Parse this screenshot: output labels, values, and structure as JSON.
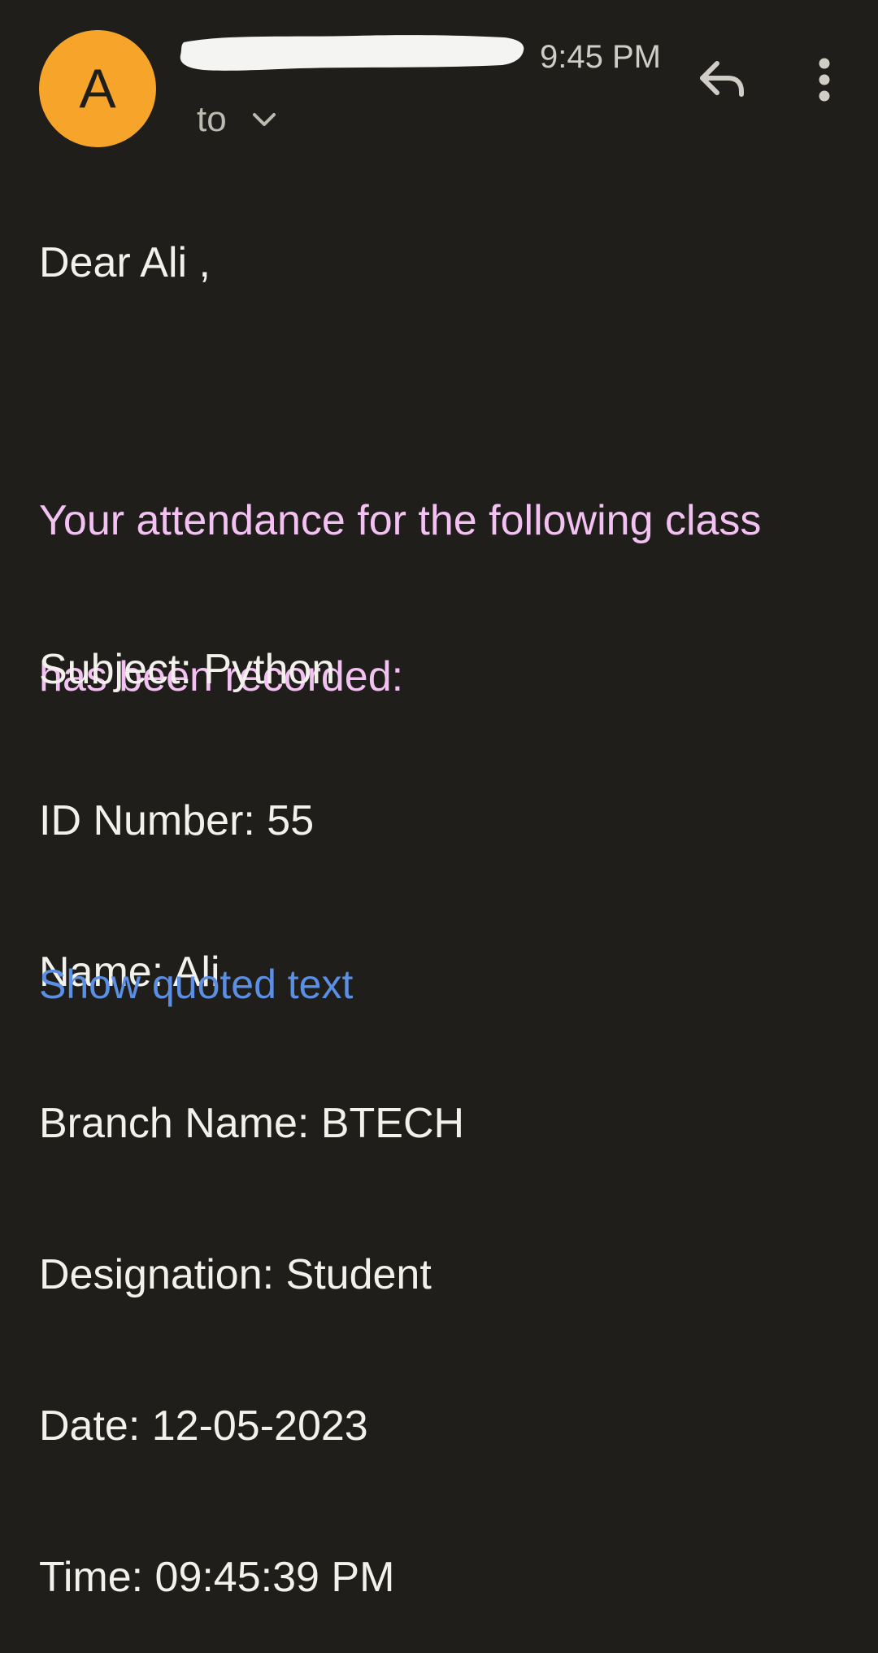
{
  "header": {
    "avatar_letter": "A",
    "time": "9:45 PM",
    "recipient_label": "to",
    "icons": {
      "reply": "reply-icon",
      "more": "more-vert-icon",
      "expand": "chevron-down-icon"
    }
  },
  "body": {
    "greeting": "Dear Ali ,",
    "intro_line_1": "Your attendance for the following class",
    "intro_line_2": "has been recorded:",
    "details": [
      "Subject: Python",
      "ID Number: 55",
      "Name: Ali",
      "Branch Name: BTECH",
      "Designation: Student",
      "Date: 12-05-2023",
      "Time: 09:45:39 PM"
    ]
  },
  "footer": {
    "show_quoted_text": "Show quoted text"
  },
  "colors": {
    "background": "#1f1e1b",
    "avatar": "#f7a52a",
    "intro_text": "#f4c2f2",
    "link": "#5b8fe4"
  }
}
